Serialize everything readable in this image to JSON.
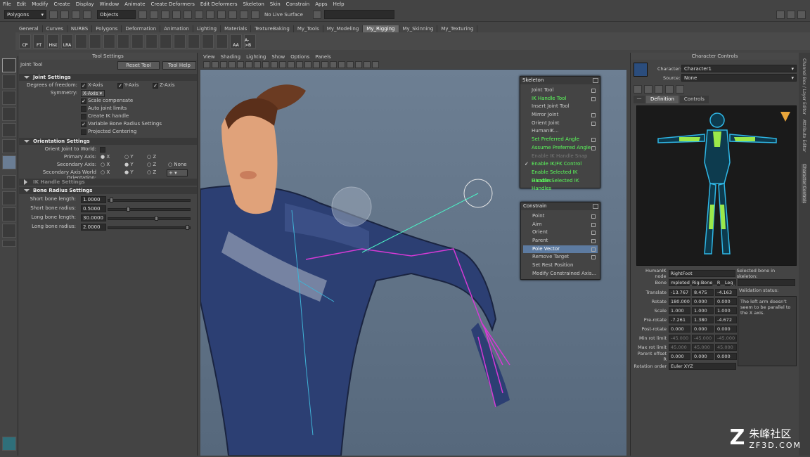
{
  "menu": [
    "File",
    "Edit",
    "Modify",
    "Create",
    "Display",
    "Window",
    "Animate",
    "Create Deformers",
    "Edit Deformers",
    "Skeleton",
    "Skin",
    "Constrain",
    "Apps",
    "Help"
  ],
  "status": {
    "mode": "Polygons",
    "objects_label": "Objects",
    "live_surface": "No Live Surface"
  },
  "shelf_tabs": [
    "General",
    "Curves",
    "NURBS",
    "Polygons",
    "Deformation",
    "Animation",
    "Lighting",
    "Materials",
    "TextureBaking",
    "My_Tools",
    "My_Modeling",
    "My_Rigging",
    "My_Skinning",
    "My_Texturing"
  ],
  "active_shelf": "My_Rigging",
  "shelf_icon_labels": [
    "CP",
    "FT",
    "Hist",
    "LRA",
    "AA",
    "A->B"
  ],
  "tool_settings": {
    "title": "Tool Settings",
    "tool_name": "Joint Tool",
    "reset_button": "Reset Tool",
    "help_button": "Tool Help",
    "joint_settings": {
      "header": "Joint Settings",
      "dof_label": "Degrees of freedom:",
      "x_axis": "X-Axis",
      "y_axis": "Y-Axis",
      "z_axis": "Z-Axis",
      "symmetry_label": "Symmetry:",
      "symmetry_value": "X-Axis",
      "scale_compensate": "Scale compensate",
      "auto_joint_limits": "Auto joint limits",
      "create_ik_handle": "Create IK handle",
      "variable_bone_radius": "Variable Bone Radius Settings",
      "projected_centering": "Projected Centering"
    },
    "orientation_settings": {
      "header": "Orientation Settings",
      "orient_world": "Orient Joint to World:",
      "primary_axis": "Primary Axis:",
      "secondary_axis": "Secondary Axis:",
      "secondary_world": "Secondary Axis World Orientation:",
      "x": "X",
      "y": "Y",
      "z": "Z",
      "none": "None",
      "plus": "+"
    },
    "ik_handle_settings": {
      "header": "IK Handle Settings"
    },
    "bone_radius": {
      "header": "Bone Radius Settings",
      "short_len_label": "Short bone length:",
      "short_len": "1.0000",
      "short_rad_label": "Short bone radius:",
      "short_rad": "0.5000",
      "long_len_label": "Long bone length:",
      "long_len": "30.0000",
      "long_rad_label": "Long bone radius:",
      "long_rad": "2.0000"
    }
  },
  "viewport_menu": [
    "View",
    "Shading",
    "Lighting",
    "Show",
    "Options",
    "Panels"
  ],
  "skeleton_menu": {
    "title": "Skeleton",
    "items": [
      {
        "label": "Joint Tool",
        "style": "normal",
        "box": true
      },
      {
        "label": "IK Handle Tool",
        "style": "green",
        "box": true
      },
      {
        "label": "Insert Joint Tool",
        "style": "normal",
        "box": false
      },
      {
        "label": "Mirror Joint",
        "style": "normal",
        "box": true
      },
      {
        "label": "Orient Joint",
        "style": "normal",
        "box": true
      },
      {
        "label": "HumanIK...",
        "style": "normal",
        "box": false
      },
      {
        "label": "Set Preferred Angle",
        "style": "green",
        "box": true
      },
      {
        "label": "Assume Preferred Angle",
        "style": "green",
        "box": true
      },
      {
        "label": "Enable IK Handle Snap",
        "style": "dim",
        "box": false
      },
      {
        "label": "Enable IK/FK Control",
        "style": "green",
        "box": false,
        "checked": true
      },
      {
        "label": "Enable Selected IK Handles",
        "style": "green",
        "box": false
      },
      {
        "label": "Disable Selected IK Handles",
        "style": "green",
        "box": false
      }
    ]
  },
  "constrain_menu": {
    "title": "Constrain",
    "items": [
      {
        "label": "Point",
        "box": true
      },
      {
        "label": "Aim",
        "box": true
      },
      {
        "label": "Orient",
        "box": true
      },
      {
        "label": "Parent",
        "box": true
      },
      {
        "label": "Pole Vector",
        "box": true,
        "highlight": true
      },
      {
        "label": "Remove Target",
        "box": true
      },
      {
        "label": "Set Rest Position",
        "box": false
      },
      {
        "label": "Modify Constrained Axis...",
        "box": false
      }
    ]
  },
  "character_controls": {
    "title": "Character Controls",
    "character_label": "Character:",
    "character_value": "Character1",
    "source_label": "Source:",
    "source_value": "None",
    "tab_definition": "Definition",
    "tab_controls": "Controls",
    "humanik_node_label": "HumanIK node",
    "humanik_node_value": "RightFoot",
    "bone_label": "Bone",
    "bone_value": "mpleted_Rig:Bone__R__Leg_Ankle",
    "selected_bone_label": "Selected bone in skeleton:",
    "validation_label": "Validation status:",
    "validation_msg": "The left arm doesn't seem to be parallel to the X axis.",
    "rows": [
      {
        "label": "Translate",
        "v": [
          "-13.767",
          "8.475",
          "-4.163"
        ]
      },
      {
        "label": "Rotate",
        "v": [
          "180.000",
          "0.000",
          "0.000"
        ]
      },
      {
        "label": "Scale",
        "v": [
          "1.000",
          "1.000",
          "1.000"
        ]
      },
      {
        "label": "Pre-rotate",
        "v": [
          "-7.261",
          "1.380",
          "-4.672"
        ]
      },
      {
        "label": "Post-rotate",
        "v": [
          "0.000",
          "0.000",
          "0.000"
        ]
      },
      {
        "label": "Min rot limit",
        "v": [
          "-45.000",
          "-45.000",
          "-45.000"
        ],
        "dim": true
      },
      {
        "label": "Max rot limit",
        "v": [
          "45.000",
          "45.000",
          "45.000"
        ],
        "dim": true
      },
      {
        "label": "Parent offset R",
        "v": [
          "0.000",
          "0.000",
          "0.000"
        ]
      }
    ],
    "rotation_order_label": "Rotation order",
    "rotation_order_value": "Euler XYZ"
  },
  "right_strip": [
    "Channel Box / Layer Editor",
    "Attribute Editor",
    "Character Controls"
  ],
  "watermark": {
    "cn": "朱峰社区",
    "en": "ZF3D.COM"
  }
}
